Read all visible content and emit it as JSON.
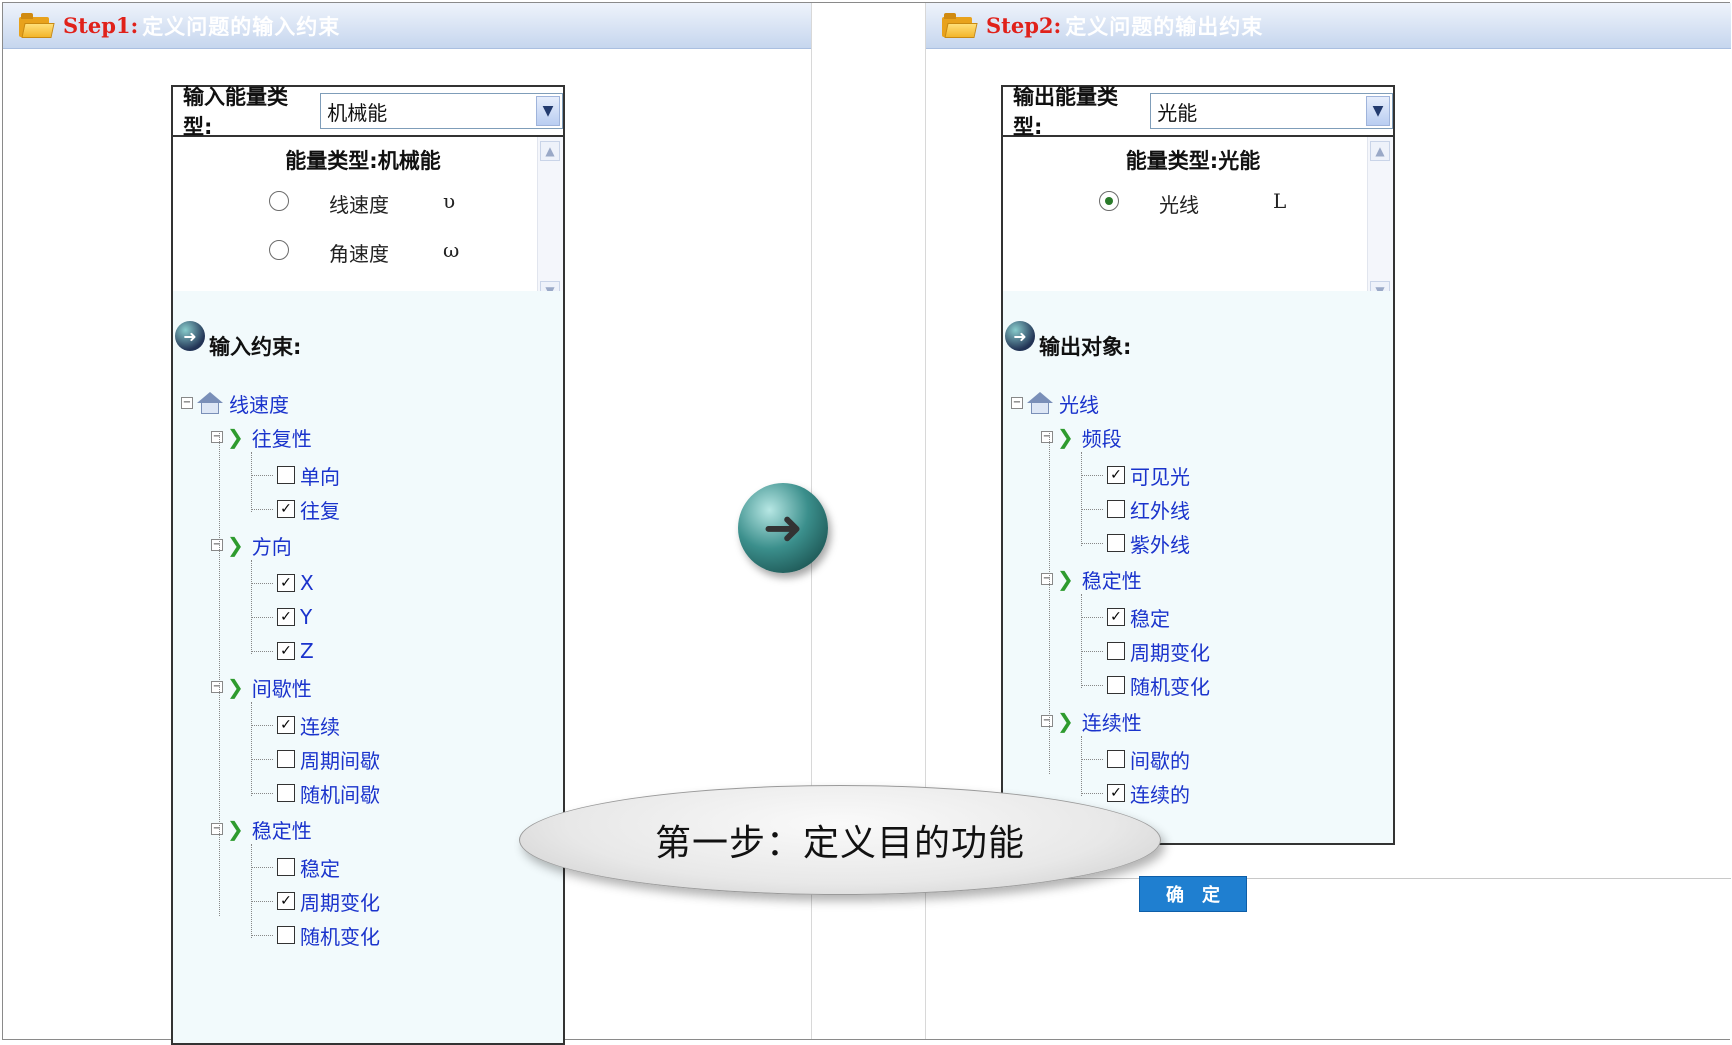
{
  "left": {
    "header": {
      "step": "Step1:",
      "title": "定义问题的输入约束"
    },
    "select_label": "输入能量类型:",
    "select_value": "机械能",
    "info_title": "能量类型:机械能",
    "options": [
      {
        "label": "线速度",
        "symbol": "υ",
        "selected": false
      },
      {
        "label": "角速度",
        "symbol": "ω",
        "selected": false
      }
    ],
    "section": "输入约束:",
    "root": "线速度",
    "groups": [
      {
        "label": "往复性",
        "items": [
          {
            "label": "单向",
            "checked": false
          },
          {
            "label": "往复",
            "checked": true
          }
        ]
      },
      {
        "label": "方向",
        "items": [
          {
            "label": "X",
            "checked": true
          },
          {
            "label": "Y",
            "checked": true
          },
          {
            "label": "Z",
            "checked": true
          }
        ]
      },
      {
        "label": "间歇性",
        "items": [
          {
            "label": "连续",
            "checked": true
          },
          {
            "label": "周期间歇",
            "checked": false
          },
          {
            "label": "随机间歇",
            "checked": false
          }
        ]
      },
      {
        "label": "稳定性",
        "items": [
          {
            "label": "稳定",
            "checked": false
          },
          {
            "label": "周期变化",
            "checked": true
          },
          {
            "label": "随机变化",
            "checked": false
          }
        ]
      }
    ]
  },
  "right": {
    "header": {
      "step": "Step2:",
      "title": "定义问题的输出约束"
    },
    "select_label": "输出能量类型:",
    "select_value": "光能",
    "info_title": "能量类型:光能",
    "options": [
      {
        "label": "光线",
        "symbol": "L",
        "selected": true
      }
    ],
    "section": "输出对象:",
    "root": "光线",
    "groups": [
      {
        "label": "频段",
        "items": [
          {
            "label": "可见光",
            "checked": true
          },
          {
            "label": "红外线",
            "checked": false
          },
          {
            "label": "紫外线",
            "checked": false
          }
        ]
      },
      {
        "label": "稳定性",
        "items": [
          {
            "label": "稳定",
            "checked": true
          },
          {
            "label": "周期变化",
            "checked": false
          },
          {
            "label": "随机变化",
            "checked": false
          }
        ]
      },
      {
        "label": "连续性",
        "items": [
          {
            "label": "间歇的",
            "checked": false
          },
          {
            "label": "连续的",
            "checked": true
          }
        ]
      }
    ]
  },
  "callout": "第一步：定义目的功能",
  "confirm_label": "确定"
}
